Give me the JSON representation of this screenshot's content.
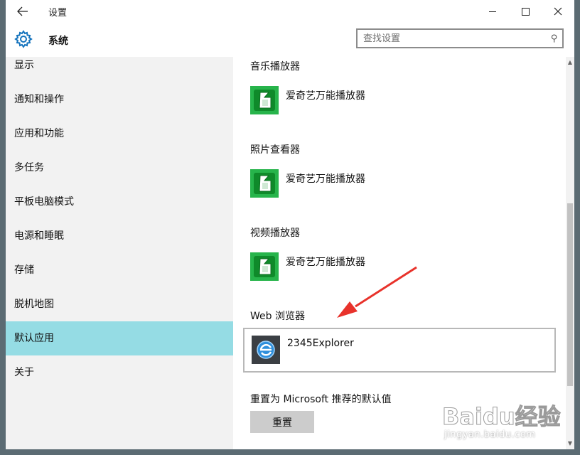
{
  "window": {
    "title": "设置"
  },
  "header": {
    "title": "系统",
    "search_placeholder": "查找设置"
  },
  "sidebar": {
    "items": [
      {
        "label": "显示"
      },
      {
        "label": "通知和操作"
      },
      {
        "label": "应用和功能"
      },
      {
        "label": "多任务"
      },
      {
        "label": "平板电脑模式"
      },
      {
        "label": "电源和睡眠"
      },
      {
        "label": "存储"
      },
      {
        "label": "脱机地图"
      },
      {
        "label": "默认应用",
        "selected": true
      },
      {
        "label": "关于"
      }
    ]
  },
  "content": {
    "music": {
      "label": "音乐播放器",
      "app": "爱奇艺万能播放器"
    },
    "photo": {
      "label": "照片查看器",
      "app": "爱奇艺万能播放器"
    },
    "video": {
      "label": "视频播放器",
      "app": "爱奇艺万能播放器"
    },
    "web": {
      "label": "Web 浏览器",
      "app": "2345Explorer"
    },
    "reset": {
      "label": "重置为 Microsoft 推荐的默认值",
      "button": "重置"
    }
  },
  "watermark": {
    "text": "Baidu经验",
    "url": "jingyan.baidu.com"
  },
  "colors": {
    "selected_nav": "#95dce4",
    "accent": "#0078d7",
    "annotation_arrow": "#e8322b"
  }
}
